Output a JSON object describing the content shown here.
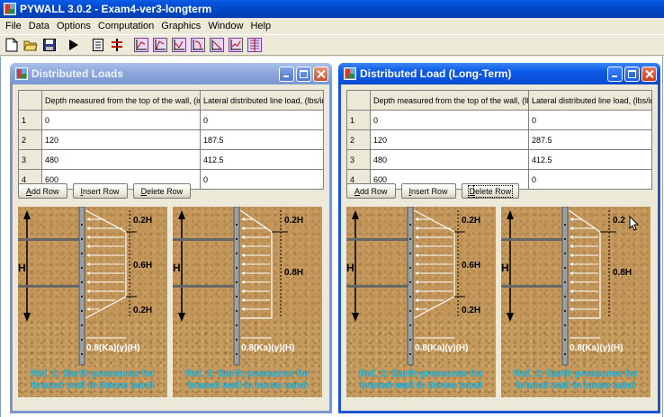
{
  "app": {
    "title": "PYWALL 3.0.2 - Exam4-ver3-longterm"
  },
  "menu": [
    "File",
    "Data",
    "Options",
    "Computation",
    "Graphics",
    "Window",
    "Help"
  ],
  "toolbar": {
    "icons": [
      "new-file-icon",
      "open-folder-icon",
      "save-icon",
      "run-icon",
      "list-icon",
      "wall-section-icon",
      "chart-1-icon",
      "chart-2-icon",
      "chart-3-icon",
      "chart-4-icon",
      "chart-5-icon",
      "chart-6-icon",
      "chart-7-icon"
    ]
  },
  "windows": [
    {
      "title": "Distributed Loads",
      "active": false,
      "columns": [
        "Depth measured from the top of the wall, (in)",
        "Lateral distributed line load,  (lbs/in)"
      ],
      "rows": [
        {
          "n": "1",
          "depth": "0",
          "load": "0"
        },
        {
          "n": "2",
          "depth": "120",
          "load": "187.5"
        },
        {
          "n": "3",
          "depth": "480",
          "load": "412.5"
        },
        {
          "n": "4",
          "depth": "600",
          "load": "0"
        }
      ],
      "buttons": {
        "add_underline": "A",
        "add_rest": "dd Row",
        "insert_underline": "I",
        "insert_rest": "nsert Row",
        "delete_underline": "D",
        "delete_rest": "elete Row"
      },
      "diagrams": [
        {
          "h": "H",
          "top": "0.2H",
          "mid": "0.6H",
          "bottom": "0.2H",
          "formula": "0.8(Ka)(γ)(H)",
          "ref_line1": "Ref. 1: Earth pressures for",
          "ref_line2": "braced wall in dense sand"
        },
        {
          "h": "H",
          "top": "0.2H",
          "mid": "0.8H",
          "formula": "0.8(Ka)(γ)(H)",
          "ref_line1": "Ref. 2: Earth pressures for",
          "ref_line2": "braced wall in loose sand"
        }
      ]
    },
    {
      "title": "Distributed Load (Long-Term)",
      "active": true,
      "columns": [
        "Depth measured from the top of the wall, (lbs)",
        "Lateral distributed line load,  (lbs/in)"
      ],
      "rows": [
        {
          "n": "1",
          "depth": "0",
          "load": "0"
        },
        {
          "n": "2",
          "depth": "120",
          "load": "287.5"
        },
        {
          "n": "3",
          "depth": "480",
          "load": "412.5"
        },
        {
          "n": "4",
          "depth": "600",
          "load": "0"
        }
      ],
      "buttons": {
        "add_underline": "A",
        "add_rest": "dd Row",
        "insert_underline": "I",
        "insert_rest": "nsert Row",
        "delete_underline": "D",
        "delete_rest": "elete Row"
      },
      "diagrams": [
        {
          "h": "H",
          "top": "0.2H",
          "mid": "0.6H",
          "bottom": "0.2H",
          "formula": "0.8(Ka)(γ)(H)",
          "ref_line1": "Ref. 1: Earth pressures for",
          "ref_line2": "braced wall in dense sand"
        },
        {
          "h": "H",
          "top": "0.2",
          "mid": "0.8H",
          "formula": "0.8(Ka)(γ)(H)",
          "ref_line1": "Ref. 2: Earth pressures for",
          "ref_line2": "braced wall in loose sand"
        }
      ]
    }
  ],
  "colors": {
    "app_titlebar": "#0048c8",
    "active_titlebar": "#0b5ae8",
    "inactive_titlebar": "#8aa5da",
    "soil": "#c59a5e",
    "ref_caption": "#31c7e8"
  }
}
